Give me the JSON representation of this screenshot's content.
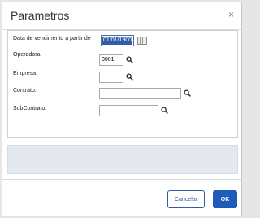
{
  "dialog": {
    "title": "Parametros",
    "close_glyph": "×"
  },
  "form": {
    "data_vencimento": {
      "label": "Data de vencimento a partir de",
      "value": "01/01/1900"
    },
    "operadora": {
      "label": "Operadora:",
      "value": "0001"
    },
    "empresa": {
      "label": "Empresa:",
      "value": ""
    },
    "contrato": {
      "label": "Contrato:",
      "value": ""
    },
    "subcontrato": {
      "label": "SubContrato:",
      "value": ""
    }
  },
  "buttons": {
    "cancel_label": "Cancelar",
    "ok_label": "OK"
  },
  "colors": {
    "primary": "#1f5bb8",
    "selection": "#2f5ea8",
    "message_area": "#e4e8ef"
  },
  "icons": [
    "close-icon",
    "calendar-icon",
    "search-icon"
  ]
}
